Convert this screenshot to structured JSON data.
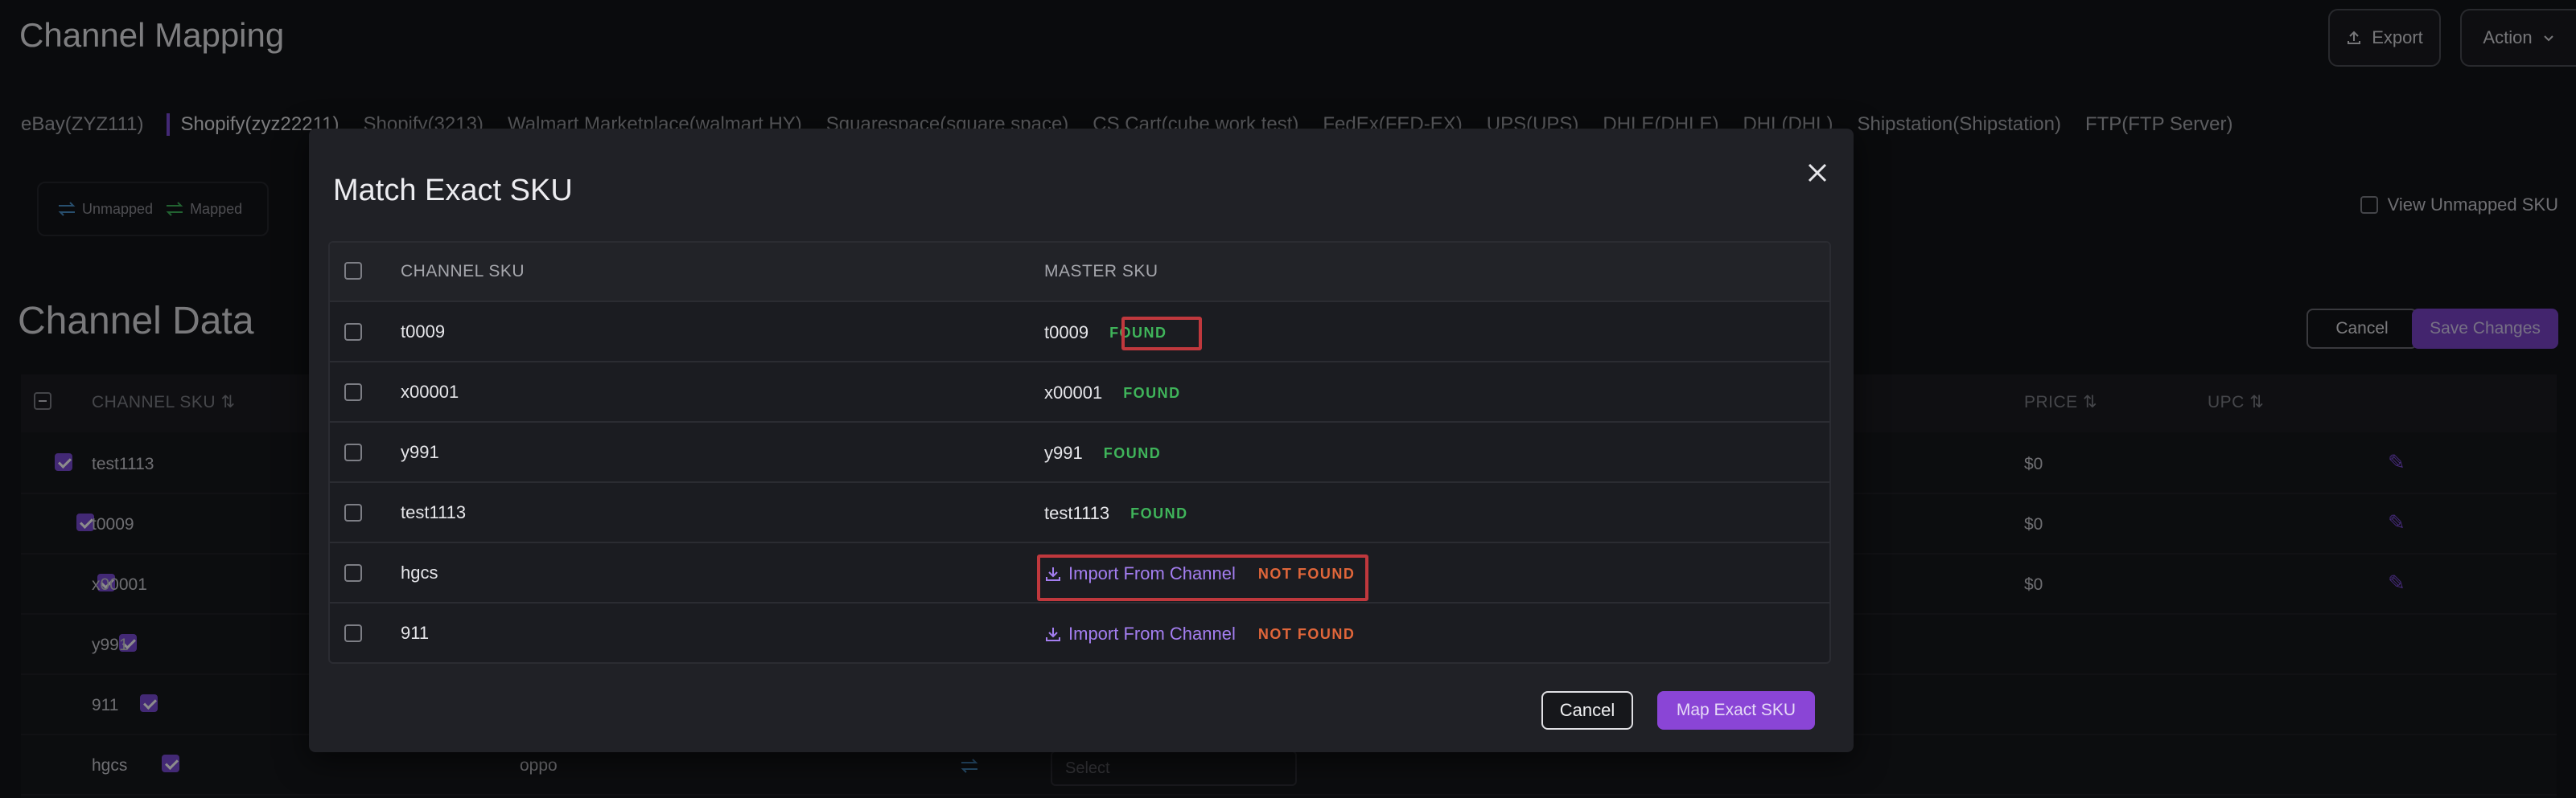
{
  "page": {
    "title": "Channel Mapping",
    "export_label": "Export",
    "action_label": "Action",
    "tabs": [
      {
        "label": "eBay(ZYZ111)"
      },
      {
        "label": "Shopify(zyz22211)"
      },
      {
        "label": "Shopify(3213)"
      },
      {
        "label": "Walmart Marketplace(walmart HY)"
      },
      {
        "label": "Squarespace(square space)"
      },
      {
        "label": "CS Cart(cube work test)"
      },
      {
        "label": "FedEx(FED-EX)"
      },
      {
        "label": "UPS(UPS)"
      },
      {
        "label": "DHLE(DHLE)"
      },
      {
        "label": "DHL(DHL)"
      },
      {
        "label": "Shipstation(Shipstation)"
      },
      {
        "label": "FTP(FTP Server)"
      }
    ],
    "legend": {
      "unmapped": "Unmapped",
      "mapped": "Mapped"
    },
    "view_unmapped_label": "View Unmapped SKU",
    "section_title": "Channel Data",
    "cancel_label": "Cancel",
    "save_label": "Save Changes",
    "table_headers": {
      "channel_sku": "CHANNEL SKU",
      "price": "PRICE",
      "upc": "UPC"
    },
    "rows": [
      {
        "sku": "test1113",
        "price": "$0"
      },
      {
        "sku": "t0009",
        "price": "$0"
      },
      {
        "sku": "x00001",
        "price": "$0"
      },
      {
        "sku": "y991",
        "price": ""
      },
      {
        "sku": "911",
        "price": ""
      },
      {
        "sku": "hgcs",
        "price": "",
        "extra": "oppo",
        "select_placeholder": "Select"
      }
    ]
  },
  "modal": {
    "title": "Match Exact SKU",
    "headers": {
      "channel_sku": "CHANNEL SKU",
      "master_sku": "MASTER SKU"
    },
    "rows": [
      {
        "channel_sku": "t0009",
        "master_sku": "t0009",
        "status": "FOUND"
      },
      {
        "channel_sku": "x00001",
        "master_sku": "x00001",
        "status": "FOUND"
      },
      {
        "channel_sku": "y991",
        "master_sku": "y991",
        "status": "FOUND"
      },
      {
        "channel_sku": "test1113",
        "master_sku": "test1113",
        "status": "FOUND"
      },
      {
        "channel_sku": "hgcs",
        "import_label": "Import From Channel",
        "status": "NOT FOUND"
      },
      {
        "channel_sku": "911",
        "import_label": "Import From Channel",
        "status": "NOT FOUND"
      }
    ],
    "cancel_label": "Cancel",
    "map_label": "Map Exact SKU"
  },
  "colors": {
    "accent": "#7b4bd6",
    "found": "#3fb45a",
    "not_found": "#e0663a",
    "highlight": "#c0383d"
  }
}
